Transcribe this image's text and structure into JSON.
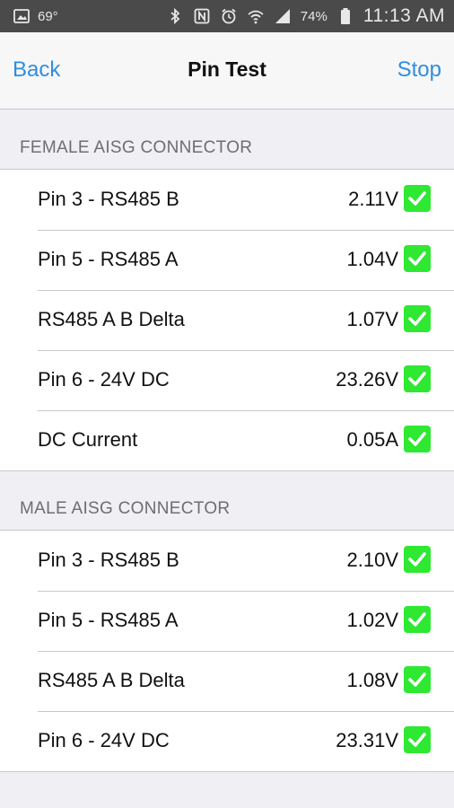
{
  "status_bar": {
    "temperature": "69°",
    "battery": "74%",
    "time": "11:13 AM"
  },
  "nav": {
    "back_label": "Back",
    "title": "Pin Test",
    "stop_label": "Stop"
  },
  "sections": [
    {
      "header": "FEMALE AISG CONNECTOR",
      "rows": [
        {
          "label": "Pin 3 - RS485 B",
          "value": "2.11V",
          "status": "pass"
        },
        {
          "label": "Pin 5 - RS485 A",
          "value": "1.04V",
          "status": "pass"
        },
        {
          "label": "RS485 A B Delta",
          "value": "1.07V",
          "status": "pass"
        },
        {
          "label": "Pin 6 - 24V DC",
          "value": "23.26V",
          "status": "pass"
        },
        {
          "label": "DC Current",
          "value": "0.05A",
          "status": "pass"
        }
      ]
    },
    {
      "header": "MALE AISG CONNECTOR",
      "rows": [
        {
          "label": "Pin 3 - RS485 B",
          "value": "2.10V",
          "status": "pass"
        },
        {
          "label": "Pin 5 - RS485 A",
          "value": "1.02V",
          "status": "pass"
        },
        {
          "label": "RS485 A B Delta",
          "value": "1.08V",
          "status": "pass"
        },
        {
          "label": "Pin 6 - 24V DC",
          "value": "23.31V",
          "status": "pass"
        }
      ]
    }
  ],
  "colors": {
    "accent": "#2f8ee0",
    "check_green": "#2ee832",
    "background": "#efeff4"
  }
}
